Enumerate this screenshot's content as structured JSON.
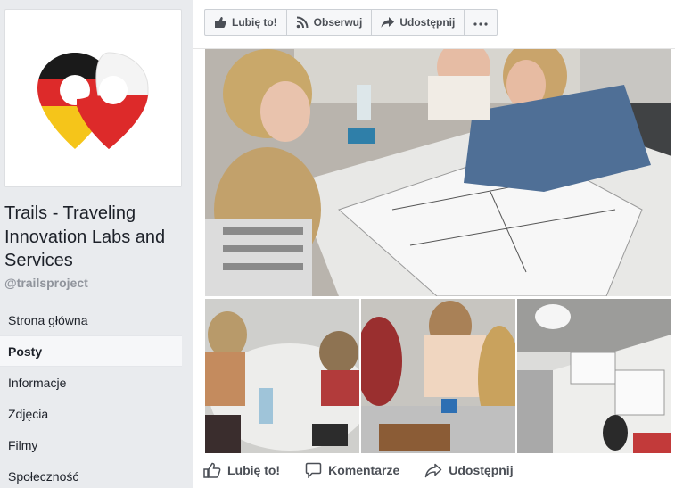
{
  "sidebar": {
    "page_name": "Trails - Traveling Innovation Labs and Services",
    "handle": "@trailsproject",
    "nav": [
      {
        "label": "Strona główna",
        "active": false
      },
      {
        "label": "Posty",
        "active": true
      },
      {
        "label": "Informacje",
        "active": false
      },
      {
        "label": "Zdjęcia",
        "active": false
      },
      {
        "label": "Filmy",
        "active": false
      },
      {
        "label": "Społeczność",
        "active": false
      }
    ]
  },
  "action_bar": {
    "like": "Lubię to!",
    "follow": "Obserwuj",
    "share": "Udostępnij",
    "more_icon": "ellipsis-icon"
  },
  "post_footer": {
    "like": "Lubię to!",
    "comment": "Komentarze",
    "share": "Udostępnij"
  },
  "colors": {
    "logo_red": "#dd2a2a",
    "logo_gold": "#f5c51a",
    "logo_black": "#1a1a1a",
    "background": "#e9ebee"
  }
}
